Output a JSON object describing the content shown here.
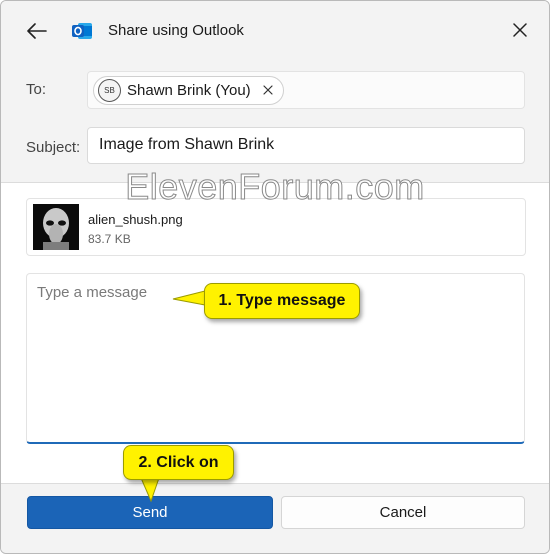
{
  "window": {
    "title": "Share using Outlook",
    "accent_color": "#1b64b7"
  },
  "titlebar": {
    "back_icon": "arrow-left-icon",
    "app_icon": "outlook-icon",
    "close_icon": "close-icon"
  },
  "to_field": {
    "label": "To:",
    "recipient": {
      "initials": "SB",
      "name": "Shawn Brink (You)"
    },
    "remove_icon": "close-icon"
  },
  "subject_field": {
    "label": "Subject:",
    "value": "Image from Shawn Brink"
  },
  "watermark": "ElevenForum.com",
  "attachment": {
    "file_name": "alien_shush.png",
    "file_size": "83.7 KB"
  },
  "message": {
    "placeholder": "Type a message",
    "value": ""
  },
  "footer": {
    "send_label": "Send",
    "cancel_label": "Cancel"
  },
  "callouts": [
    {
      "label": "1. Type message",
      "color": "#fff200"
    },
    {
      "label": "2. Click on",
      "color": "#fff200"
    }
  ]
}
